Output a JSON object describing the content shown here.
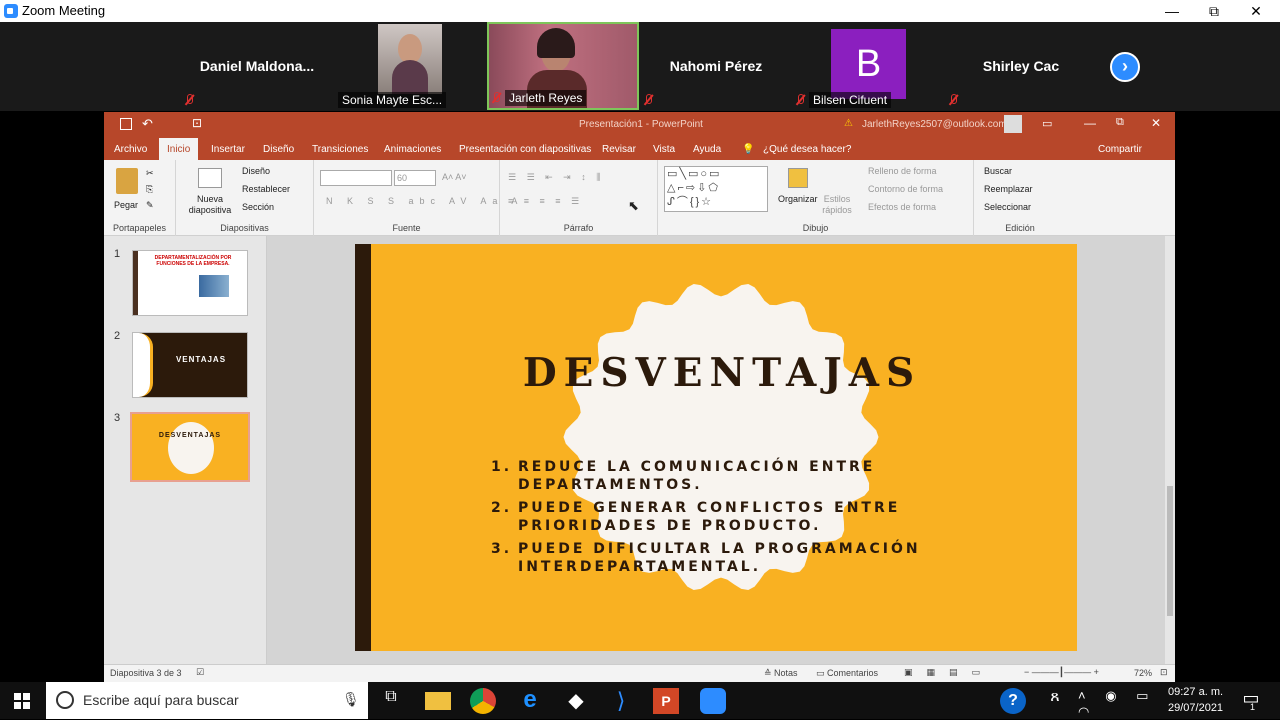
{
  "window": {
    "title": "Zoom Meeting",
    "minimize": "—",
    "restore": "⧉",
    "close": "✕"
  },
  "participants": [
    {
      "name": "Daniel  Maldona...",
      "muted": true
    },
    {
      "name": "Sonia Mayte Esc...",
      "muted": false
    },
    {
      "name": "Jarleth Reyes",
      "muted": true
    },
    {
      "name": "Nahomi Pérez",
      "muted": true
    },
    {
      "name": "Bilsen Cifuent",
      "initial": "B",
      "muted": true
    },
    {
      "name": "Shirley Cac",
      "muted": true
    }
  ],
  "ppt": {
    "title": "Presentación1 - PowerPoint",
    "account": "JarlethReyes2507@outlook.com",
    "menu": [
      "Archivo",
      "Inicio",
      "Insertar",
      "Diseño",
      "Transiciones",
      "Animaciones",
      "Presentación con diapositivas",
      "Revisar",
      "Vista",
      "Ayuda"
    ],
    "tell_me": "¿Qué desea hacer?",
    "share": "Compartir",
    "ribbon": {
      "groups": [
        "Portapapeles",
        "Diapositivas",
        "Fuente",
        "Párrafo",
        "Dibujo",
        "Edición"
      ],
      "paste": "Pegar",
      "new_slide": "Nueva diapositiva",
      "layout": "Diseño",
      "reset": "Restablecer",
      "section": "Sección",
      "font_size": "60",
      "font_buttons": [
        "N",
        "K",
        "S",
        "S",
        "abc",
        "AV",
        "Aa",
        "A"
      ],
      "arrange": "Organizar",
      "quick_styles": "Estilos rápidos",
      "fill": "Relleno de forma",
      "outline": "Contorno de forma",
      "effects": "Efectos de forma",
      "find": "Buscar",
      "replace": "Reemplazar",
      "select": "Seleccionar"
    },
    "thumbs": [
      {
        "num": "1",
        "title": "DEPARTAMENTALIZACIÓN  POR FUNCIONES DE LA EMPRESA."
      },
      {
        "num": "2",
        "title": "VENTAJAS"
      },
      {
        "num": "3",
        "title": "DESVENTAJAS"
      }
    ],
    "slide": {
      "title": "DESVENTAJAS",
      "items": [
        {
          "n": "1.",
          "text": "REDUCE LA COMUNICACIÓN ENTRE DEPARTAMENTOS."
        },
        {
          "n": "2.",
          "text": "PUEDE GENERAR CONFLICTOS ENTRE PRIORIDADES DE PRODUCTO."
        },
        {
          "n": "3.",
          "text": "PUEDE DIFICULTAR LA PROGRAMACIÓN INTERDEPARTAMENTAL."
        }
      ]
    },
    "status": {
      "slide_info": "Diapositiva 3 de 3",
      "notes": "Notas",
      "comments": "Comentarios",
      "zoom": "72%"
    }
  },
  "taskbar": {
    "search_placeholder": "Escribe aquí para buscar",
    "time": "09:27 a. m.",
    "date": "29/07/2021",
    "notif": "1"
  }
}
